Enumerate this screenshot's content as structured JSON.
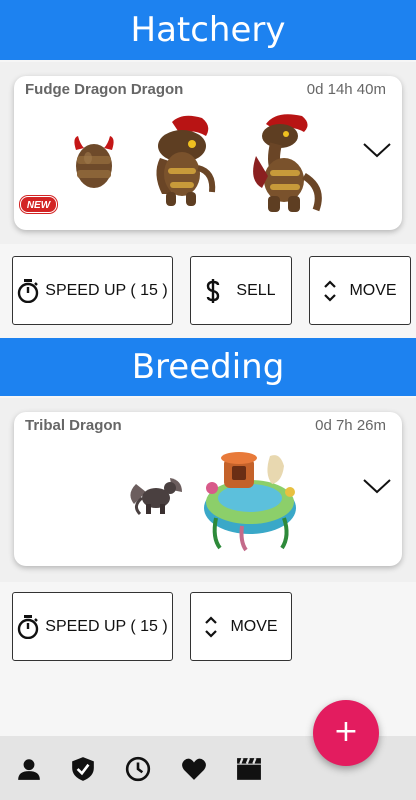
{
  "hatchery": {
    "title": "Hatchery",
    "card": {
      "name": "Fudge Dragon Dragon",
      "timer": "0d 14h 40m",
      "badge": "NEW"
    },
    "actions": {
      "speed_up": "SPEED UP ( 15 )",
      "sell": "SELL",
      "move": "MOVE"
    }
  },
  "breeding": {
    "title": "Breeding",
    "card": {
      "name": "Tribal Dragon",
      "timer": "0d 7h 26m"
    },
    "actions": {
      "speed_up": "SPEED UP ( 15 )",
      "move": "MOVE"
    }
  },
  "fab": {
    "label": "+"
  },
  "nav": {
    "icons": [
      "person-icon",
      "shield-check-icon",
      "clock-icon",
      "heart-icon",
      "clapperboard-icon"
    ]
  },
  "colors": {
    "header": "#1d82f0",
    "fab": "#e31c5f",
    "badge": "#d32424"
  }
}
